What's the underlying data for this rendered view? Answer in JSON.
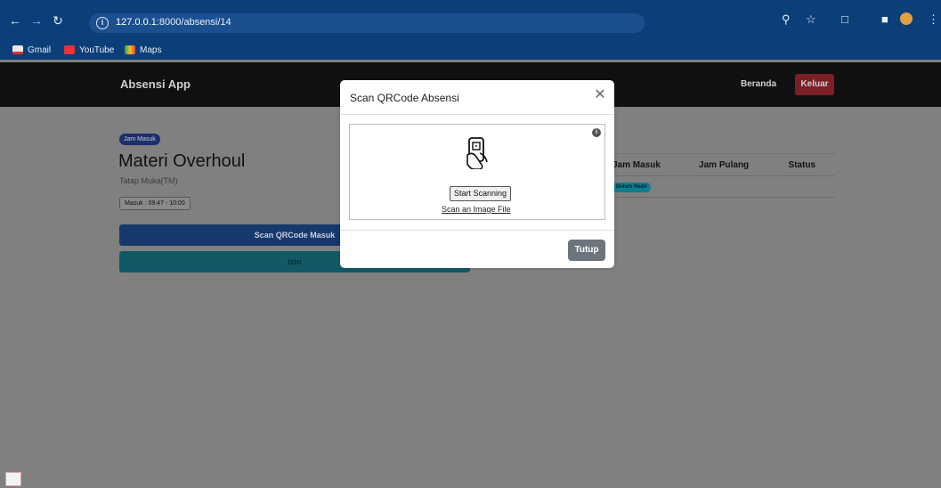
{
  "browser": {
    "url_host": "127.0.0.1",
    "url_rest": ":8000/absensi/14",
    "bookmarks": [
      "Gmail",
      "YouTube",
      "Maps"
    ]
  },
  "navbar": {
    "brand": "Absensi App",
    "home_link": "Beranda",
    "logout_label": "Keluar"
  },
  "session": {
    "badge": "Jam Masuk",
    "title": "Materi Overhoul",
    "subtitle": "Tatap Muka(TM)",
    "time": "Masuk : 09:47 - 10:00",
    "scan_button": "Scan QRCode Masuk",
    "izin_button": "Izin"
  },
  "table": {
    "headers": [
      "Jam Masuk",
      "Jam Pulang",
      "Status"
    ],
    "row_status": "Belum Hadir"
  },
  "modal": {
    "title": "Scan QRCode Absensi",
    "start_label": "Start Scanning",
    "image_link": "Scan an Image File",
    "close_label": "Tutup"
  }
}
